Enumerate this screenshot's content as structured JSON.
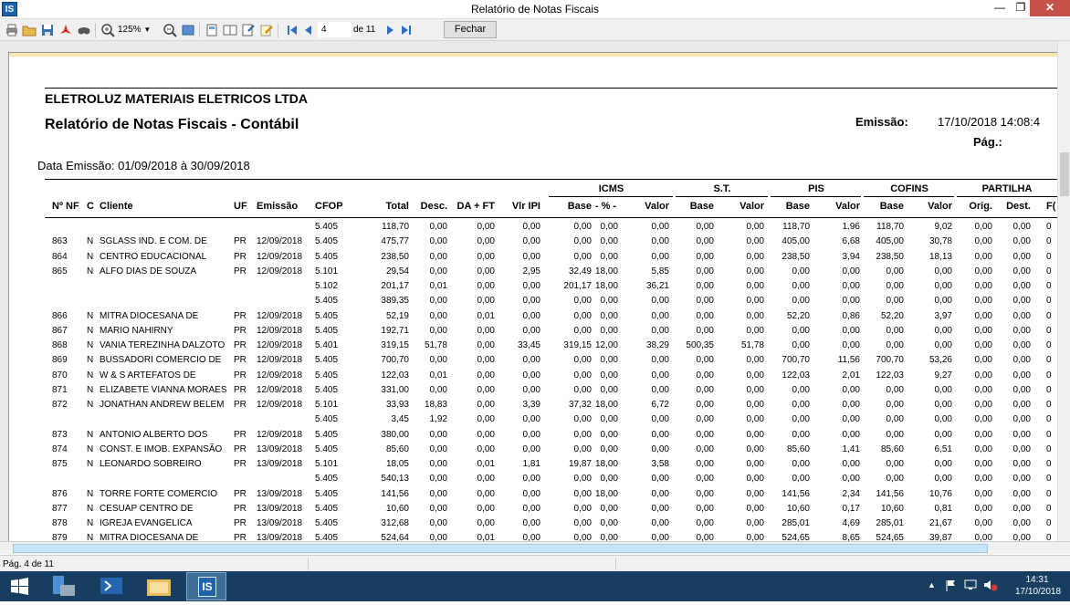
{
  "window": {
    "title": "Relatório de Notas Fiscais",
    "logo": "IS",
    "minimize": "—",
    "restore": "❐",
    "close": "✕"
  },
  "toolbar": {
    "zoom": "125%",
    "page": "4",
    "page_of": "de 11",
    "close_label": "Fechar"
  },
  "report": {
    "company": "ELETROLUZ MATERIAIS ELETRICOS LTDA",
    "title": "Relatório de Notas Fiscais - Contábil",
    "emissao_label": "Emissão:",
    "emissao_value": "17/10/2018 14:08:4",
    "pag_label": "Pág.:",
    "period": "Data Emissão: 01/09/2018 à 30/09/2018",
    "groups": [
      "ICMS",
      "S.T.",
      "PIS",
      "COFINS",
      "PARTILHA"
    ],
    "columns": [
      "Nº NF",
      "C",
      "Cliente",
      "UF",
      "Emissão",
      "CFOP",
      "Total",
      "Desc.",
      "DA + FT",
      "Vlr IPI",
      "Base",
      "- % -",
      "Valor",
      "Base",
      "Valor",
      "Base",
      "Valor",
      "Base",
      "Valor",
      "Orig.",
      "Dest.",
      "F("
    ],
    "rows": [
      [
        "",
        "",
        "",
        "",
        "",
        "5.405",
        "118,70",
        "0,00",
        "0,00",
        "0,00",
        "0,00",
        "0,00",
        "0,00",
        "0,00",
        "0,00",
        "118,70",
        "1,96",
        "118,70",
        "9,02",
        "0,00",
        "0,00",
        "0"
      ],
      [
        "863",
        "N",
        "SGLASS IND. E COM. DE",
        "PR",
        "12/09/2018",
        "5.405",
        "475,77",
        "0,00",
        "0,00",
        "0,00",
        "0,00",
        "0,00",
        "0,00",
        "0,00",
        "0,00",
        "405,00",
        "6,68",
        "405,00",
        "30,78",
        "0,00",
        "0,00",
        "0"
      ],
      [
        "864",
        "N",
        "CENTRO EDUCACIONAL",
        "PR",
        "12/09/2018",
        "5.405",
        "238,50",
        "0,00",
        "0,00",
        "0,00",
        "0,00",
        "0,00",
        "0,00",
        "0,00",
        "0,00",
        "238,50",
        "3,94",
        "238,50",
        "18,13",
        "0,00",
        "0,00",
        "0"
      ],
      [
        "865",
        "N",
        "ALFO DIAS DE SOUZA",
        "PR",
        "12/09/2018",
        "5.101",
        "29,54",
        "0,00",
        "0,00",
        "2,95",
        "32,49",
        "18,00",
        "5,85",
        "0,00",
        "0,00",
        "0,00",
        "0,00",
        "0,00",
        "0,00",
        "0,00",
        "0,00",
        "0"
      ],
      [
        "",
        "",
        "",
        "",
        "",
        "5.102",
        "201,17",
        "0,01",
        "0,00",
        "0,00",
        "201,17",
        "18,00",
        "36,21",
        "0,00",
        "0,00",
        "0,00",
        "0,00",
        "0,00",
        "0,00",
        "0,00",
        "0,00",
        "0"
      ],
      [
        "",
        "",
        "",
        "",
        "",
        "5.405",
        "389,35",
        "0,00",
        "0,00",
        "0,00",
        "0,00",
        "0,00",
        "0,00",
        "0,00",
        "0,00",
        "0,00",
        "0,00",
        "0,00",
        "0,00",
        "0,00",
        "0,00",
        "0"
      ],
      [
        "866",
        "N",
        "MITRA DIOCESANA DE",
        "PR",
        "12/09/2018",
        "5.405",
        "52,19",
        "0,00",
        "0,01",
        "0,00",
        "0,00",
        "0,00",
        "0,00",
        "0,00",
        "0,00",
        "52,20",
        "0,86",
        "52,20",
        "3,97",
        "0,00",
        "0,00",
        "0"
      ],
      [
        "867",
        "N",
        "MARIO NAHIRNY",
        "PR",
        "12/09/2018",
        "5.405",
        "192,71",
        "0,00",
        "0,00",
        "0,00",
        "0,00",
        "0,00",
        "0,00",
        "0,00",
        "0,00",
        "0,00",
        "0,00",
        "0,00",
        "0,00",
        "0,00",
        "0,00",
        "0"
      ],
      [
        "868",
        "N",
        "VANIA TEREZINHA DALZOTO",
        "PR",
        "12/09/2018",
        "5.401",
        "319,15",
        "51,78",
        "0,00",
        "33,45",
        "319,15",
        "12,00",
        "38,29",
        "500,35",
        "51,78",
        "0,00",
        "0,00",
        "0,00",
        "0,00",
        "0,00",
        "0,00",
        "0"
      ],
      [
        "869",
        "N",
        "BUSSADORI COMERCIO DE",
        "PR",
        "12/09/2018",
        "5.405",
        "700,70",
        "0,00",
        "0,00",
        "0,00",
        "0,00",
        "0,00",
        "0,00",
        "0,00",
        "0,00",
        "700,70",
        "11,56",
        "700,70",
        "53,26",
        "0,00",
        "0,00",
        "0"
      ],
      [
        "870",
        "N",
        "W & S ARTEFATOS DE",
        "PR",
        "12/09/2018",
        "5.405",
        "122,03",
        "0,01",
        "0,00",
        "0,00",
        "0,00",
        "0,00",
        "0,00",
        "0,00",
        "0,00",
        "122,03",
        "2,01",
        "122,03",
        "9,27",
        "0,00",
        "0,00",
        "0"
      ],
      [
        "871",
        "N",
        "ELIZABETE VIANNA MORAES",
        "PR",
        "12/09/2018",
        "5.405",
        "331,00",
        "0,00",
        "0,00",
        "0,00",
        "0,00",
        "0,00",
        "0,00",
        "0,00",
        "0,00",
        "0,00",
        "0,00",
        "0,00",
        "0,00",
        "0,00",
        "0,00",
        "0"
      ],
      [
        "872",
        "N",
        "JONATHAN ANDREW BELEM",
        "PR",
        "12/09/2018",
        "5.101",
        "33,93",
        "18,83",
        "0,00",
        "3,39",
        "37,32",
        "18,00",
        "6,72",
        "0,00",
        "0,00",
        "0,00",
        "0,00",
        "0,00",
        "0,00",
        "0,00",
        "0,00",
        "0"
      ],
      [
        "",
        "",
        "",
        "",
        "",
        "5.405",
        "3,45",
        "1,92",
        "0,00",
        "0,00",
        "0,00",
        "0,00",
        "0,00",
        "0,00",
        "0,00",
        "0,00",
        "0,00",
        "0,00",
        "0,00",
        "0,00",
        "0,00",
        "0"
      ],
      [
        "873",
        "N",
        "ANTONIO ALBERTO DOS",
        "PR",
        "12/09/2018",
        "5.405",
        "380,00",
        "0,00",
        "0,00",
        "0,00",
        "0,00",
        "0,00",
        "0,00",
        "0,00",
        "0,00",
        "0,00",
        "0,00",
        "0,00",
        "0,00",
        "0,00",
        "0,00",
        "0"
      ],
      [
        "874",
        "N",
        "CONST. E IMOB. EXPANSÃO",
        "PR",
        "13/09/2018",
        "5.405",
        "85,60",
        "0,00",
        "0,00",
        "0,00",
        "0,00",
        "0,00",
        "0,00",
        "0,00",
        "0,00",
        "85,60",
        "1,41",
        "85,60",
        "6,51",
        "0,00",
        "0,00",
        "0"
      ],
      [
        "875",
        "N",
        "LEONARDO SOBREIRO",
        "PR",
        "13/09/2018",
        "5.101",
        "18,05",
        "0,00",
        "0,01",
        "1,81",
        "19,87",
        "18,00",
        "3,58",
        "0,00",
        "0,00",
        "0,00",
        "0,00",
        "0,00",
        "0,00",
        "0,00",
        "0,00",
        "0"
      ],
      [
        "",
        "",
        "",
        "",
        "",
        "5.405",
        "540,13",
        "0,00",
        "0,00",
        "0,00",
        "0,00",
        "0,00",
        "0,00",
        "0,00",
        "0,00",
        "0,00",
        "0,00",
        "0,00",
        "0,00",
        "0,00",
        "0,00",
        "0"
      ],
      [
        "876",
        "N",
        "TORRE FORTE COMERCIO",
        "PR",
        "13/09/2018",
        "5.405",
        "141,56",
        "0,00",
        "0,00",
        "0,00",
        "0,00",
        "18,00",
        "0,00",
        "0,00",
        "0,00",
        "141,56",
        "2,34",
        "141,56",
        "10,76",
        "0,00",
        "0,00",
        "0"
      ],
      [
        "877",
        "N",
        "CESUAP CENTRO DE",
        "PR",
        "13/09/2018",
        "5.405",
        "10,60",
        "0,00",
        "0,00",
        "0,00",
        "0,00",
        "0,00",
        "0,00",
        "0,00",
        "0,00",
        "10,60",
        "0,17",
        "10,60",
        "0,81",
        "0,00",
        "0,00",
        "0"
      ],
      [
        "878",
        "N",
        "IGREJA EVANGELICA",
        "PR",
        "13/09/2018",
        "5.405",
        "312,68",
        "0,00",
        "0,00",
        "0,00",
        "0,00",
        "0,00",
        "0,00",
        "0,00",
        "0,00",
        "285,01",
        "4,69",
        "285,01",
        "21,67",
        "0,00",
        "0,00",
        "0"
      ],
      [
        "879",
        "N",
        "MITRA DIOCESANA DE",
        "PR",
        "13/09/2018",
        "5.405",
        "524,64",
        "0,00",
        "0,01",
        "0,00",
        "0,00",
        "0,00",
        "0,00",
        "0,00",
        "0,00",
        "524,65",
        "8,65",
        "524,65",
        "39,87",
        "0,00",
        "0,00",
        "0"
      ]
    ]
  },
  "status": {
    "page_text": "Pág. 4 de 11"
  },
  "taskbar": {
    "time": "14:31",
    "date": "17/10/2018",
    "is_label": "IS"
  },
  "colors": {
    "taskbar": "#173d60",
    "scroll_thumb": "#c7e5f8",
    "close_button": "#c7504a"
  }
}
